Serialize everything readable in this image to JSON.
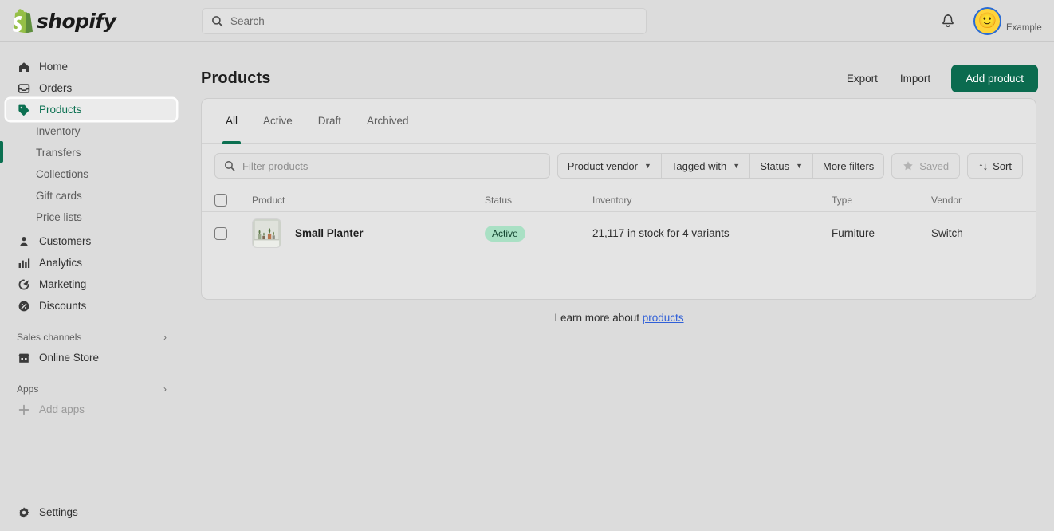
{
  "brand": {
    "name": "shopify",
    "green": "#95bf47",
    "dark_green": "#0b6b4f",
    "accent": "#0b7051"
  },
  "topbar": {
    "search_placeholder": "Search",
    "search_value": "",
    "notifications_label": "Notifications",
    "account_name": "Example",
    "avatar_emoji": "🙂"
  },
  "sidebar": {
    "items": [
      {
        "label": "Home",
        "icon": "home-icon"
      },
      {
        "label": "Orders",
        "icon": "orders-icon"
      },
      {
        "label": "Products",
        "icon": "tag-icon",
        "active": true
      },
      {
        "label": "Inventory",
        "icon": "",
        "sub": true
      },
      {
        "label": "Transfers",
        "icon": "",
        "sub": true
      },
      {
        "label": "Collections",
        "icon": "",
        "sub": true
      },
      {
        "label": "Gift cards",
        "icon": "",
        "sub": true
      },
      {
        "label": "Price lists",
        "icon": "",
        "sub": true
      },
      {
        "label": "Customers",
        "icon": "customers-icon"
      },
      {
        "label": "Analytics",
        "icon": "analytics-icon"
      },
      {
        "label": "Marketing",
        "icon": "marketing-icon"
      },
      {
        "label": "Discounts",
        "icon": "discounts-icon"
      }
    ],
    "sales_channels": {
      "label": "Sales channels",
      "chevron": "›"
    },
    "online_store": {
      "label": "Online Store",
      "icon": "store-icon"
    },
    "apps": {
      "label": "Apps",
      "chevron": "›"
    },
    "add_apps": {
      "label": "Add apps",
      "icon": "plus-icon"
    },
    "settings": {
      "label": "Settings",
      "icon": "gear-icon"
    }
  },
  "page": {
    "title": "Products",
    "export_label": "Export",
    "import_label": "Import",
    "add_product_label": "Add product"
  },
  "tabs": [
    {
      "label": "All",
      "active": true
    },
    {
      "label": "Active",
      "active": false
    },
    {
      "label": "Draft",
      "active": false
    },
    {
      "label": "Archived",
      "active": false
    }
  ],
  "filters": {
    "search_placeholder": "Filter products",
    "search_value": "",
    "product_vendor": "Product vendor",
    "tagged_with": "Tagged with",
    "status": "Status",
    "more_filters": "More filters",
    "saved": "Saved",
    "sort": "Sort",
    "caret": "▼",
    "sort_icon": "↑↓"
  },
  "table": {
    "headers": {
      "product": "Product",
      "status": "Status",
      "inventory": "Inventory",
      "type": "Type",
      "vendor": "Vendor"
    },
    "rows": [
      {
        "product": "Small Planter",
        "status": "Active",
        "inventory": "21,117 in stock for 4 variants",
        "type": "Furniture",
        "vendor": "Switch"
      }
    ]
  },
  "footer": {
    "learn_prefix": "Learn more about ",
    "learn_link": "products"
  }
}
